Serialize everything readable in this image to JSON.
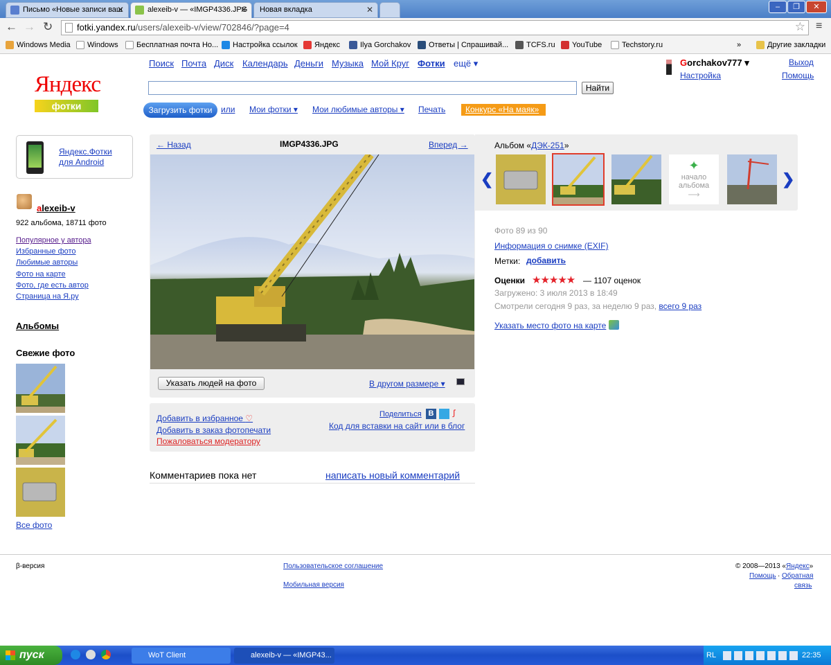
{
  "browser": {
    "tabs": [
      {
        "label": "Письмо «Новые записи ваш",
        "active": false
      },
      {
        "label": "alexeib-v — «IMGP4336.JPG",
        "active": true
      },
      {
        "label": "Новая вкладка",
        "active": false
      }
    ],
    "url_host": "fotki.yandex.ru",
    "url_path": "/users/alexeib-v/view/702846/?page=4",
    "bookmarks": [
      "Windows Media",
      "Windows",
      "Бесплатная почта Ho...",
      "Настройка ссылок",
      "Яндекс",
      "Ilya Gorchakov",
      "Ответы | Спрашивай...",
      "TCFS.ru",
      "YouTube",
      "Techstory.ru"
    ],
    "bookmarks_more": "»",
    "other_bookmarks": "Другие закладки"
  },
  "logo": {
    "yandex": "Яндекс",
    "fotki": "фотки"
  },
  "nav": {
    "items": [
      "Поиск",
      "Почта",
      "Диск",
      "Календарь",
      "Деньги",
      "Музыка",
      "Мой Круг",
      "Фотки",
      "ещё ▾"
    ]
  },
  "search": {
    "value": "",
    "button": "Найти"
  },
  "user": {
    "name_first": "G",
    "name_rest": "orchakov777 ▾",
    "settings": "Настройка",
    "logout": "Выход",
    "help": "Помощь"
  },
  "subnav": {
    "upload": "Загрузить фотки",
    "or": "или",
    "my_photos": "Мои фотки ▾",
    "fav_authors": "Мои любимые авторы ▾",
    "print": "Печать",
    "contest": "Конкурс «На маяк»"
  },
  "sidebar": {
    "android_line1": "Яндекс.Фотки",
    "android_line2": "для Android",
    "author_first": "a",
    "author_rest": "lexeib-v",
    "stats": "922 альбома, 18711 фото",
    "links": [
      "Популярное у автора",
      "Избранные фото",
      "Любимые авторы",
      "Фото на карте",
      "Фото, где есть автор",
      "Страница на Я.ру"
    ],
    "albums": "Альбомы",
    "fresh": "Свежие фото",
    "all_photos": "Все фото"
  },
  "photo": {
    "back": "← Назад",
    "title": "IMGP4336.JPG",
    "forward": "Вперед →",
    "mark_people": "Указать людей на фото",
    "other_size": "В другом размере ▾"
  },
  "actions": {
    "add_fav": "Добавить в избранное",
    "add_print": "Добавить в заказ фотопечати",
    "complain": "Пожаловаться модератору",
    "share": "Поделиться",
    "embed": "Код для вставки на сайт или в блог"
  },
  "comments": {
    "none": "Комментариев пока нет",
    "write": "написать новый комментарий"
  },
  "album": {
    "prefix": "Альбом «",
    "name": "ДЭК-251",
    "suffix": "»",
    "start_line1": "начало",
    "start_line2": "альбома"
  },
  "info": {
    "counter": "Фото 89 из 90",
    "exif": "Информация о снимке (EXIF)",
    "tags_label": "Метки:",
    "tags_add": "добавить",
    "ratings_label": "Оценки",
    "stars": "★★★★★",
    "ratings_count": "— 1107 оценок",
    "uploaded": "Загружено:  3 июля 2013 в 18:49",
    "views": "Смотрели сегодня 9 раз, за неделю 9 раз,",
    "views_total": "всего 9 раз",
    "map": "Указать место фото на карте"
  },
  "footer": {
    "beta": "β-версия",
    "agreement": "Пользовательское соглашение",
    "mobile": "Мобильная версия",
    "copy": "© 2008—2013 «",
    "copy_link": "Яндекс",
    "copy_end": "»",
    "help": "Помощь",
    "feedback1": "Обратная",
    "feedback2": "связь"
  },
  "taskbar": {
    "start": "пуск",
    "tasks": [
      "WoT Client",
      "alexeib-v — «IMGP43..."
    ],
    "lang": "RL",
    "time": "22:35"
  },
  "colors": {
    "link": "#1a3dc1",
    "star": "#e4232b",
    "contest": "#f59b16",
    "selected_thumb": "#e03c2b"
  }
}
